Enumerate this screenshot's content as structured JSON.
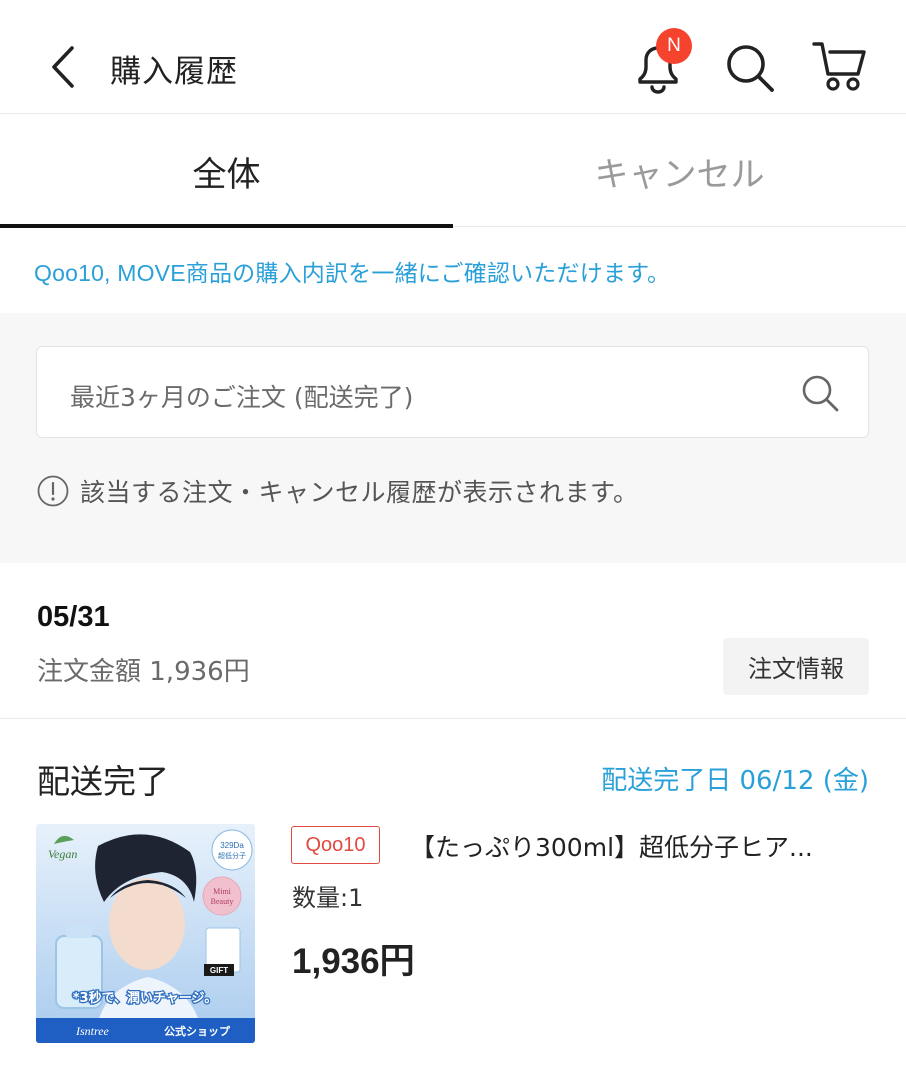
{
  "header": {
    "title": "購入履歴",
    "notification_badge": "N",
    "icons": [
      "chevron-left-icon",
      "bell-icon",
      "search-icon",
      "cart-icon"
    ]
  },
  "tabs": [
    {
      "label": "全体",
      "active": true
    },
    {
      "label": "キャンセル",
      "active": false
    }
  ],
  "notice": "Qoo10, MOVE商品の購入内訳を一緒にご確認いただけます。",
  "search": {
    "placeholder": "最近3ヶ月のご注文 (配送完了)"
  },
  "info": "該当する注文・キャンセル履歴が表示されます。",
  "order": {
    "date": "05/31",
    "amount": "注文金額 1,936円",
    "info_button": "注文情報",
    "status": "配送完了",
    "delivery_date": "配送完了日 06/12 (金)",
    "item": {
      "platform_badge": "Qoo10",
      "name": "【たっぷり300ml】超低分子ヒア...",
      "quantity": "数量:1",
      "price": "1,936円",
      "image_text": {
        "vegan": "Vegan",
        "dalton": "329Da",
        "molecule": "超低分子",
        "award_line1": "Mimi",
        "award_line2": "Beauty",
        "gift": "GIFT",
        "tagline": "*3秒で、潤いチャージ。",
        "brand": "Isntree",
        "shop": "公式ショップ"
      }
    }
  },
  "colors": {
    "accent_blue": "#2aa0d8",
    "badge_red": "#f5432e",
    "qoo10_red": "#e04a3f"
  }
}
